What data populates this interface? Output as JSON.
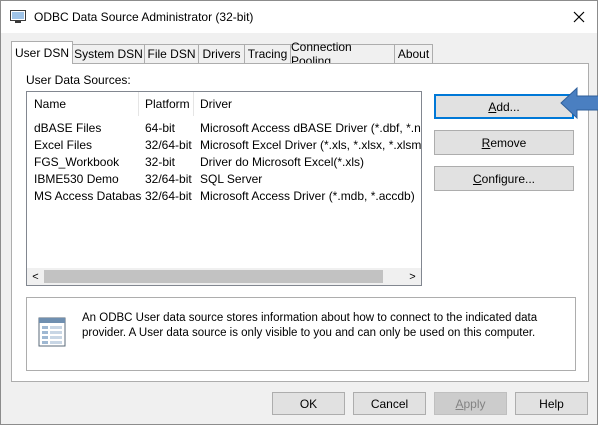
{
  "window": {
    "title": "ODBC Data Source Administrator (32-bit)"
  },
  "tabs": [
    "User DSN",
    "System DSN",
    "File DSN",
    "Drivers",
    "Tracing",
    "Connection Pooling",
    "About"
  ],
  "active_tab": "User DSN",
  "list": {
    "label": "User Data Sources:",
    "columns": [
      "Name",
      "Platform",
      "Driver"
    ],
    "rows": [
      [
        "dBASE Files",
        "64-bit",
        "Microsoft Access dBASE Driver (*.dbf, *.ndx, *.r"
      ],
      [
        "Excel Files",
        "32/64-bit",
        "Microsoft Excel Driver (*.xls, *.xlsx, *.xlsm, *.xlsb"
      ],
      [
        "FGS_Workbook",
        "32-bit",
        "Driver do Microsoft Excel(*.xls)"
      ],
      [
        "IBME530 Demo",
        "32/64-bit",
        "SQL Server"
      ],
      [
        "MS Access Database",
        "32/64-bit",
        "Microsoft Access Driver (*.mdb, *.accdb)"
      ]
    ],
    "scroll_left": "<",
    "scroll_right": ">"
  },
  "side_buttons": {
    "add_pre": "",
    "add_u": "A",
    "add_post": "dd...",
    "remove_u": "R",
    "remove_post": "emove",
    "configure_pre": "",
    "configure_u": "C",
    "configure_post": "onfigure..."
  },
  "info": {
    "text": "An ODBC User data source stores information about how to connect to the indicated data provider.   A User data source is only visible to you and can only be used on this computer."
  },
  "bottom_buttons": {
    "ok": "OK",
    "cancel": "Cancel",
    "apply_u": "A",
    "apply_post": "pply",
    "help": "Help"
  },
  "colors": {
    "accent": "#0078d7",
    "arrow": "#4a7fc1"
  }
}
